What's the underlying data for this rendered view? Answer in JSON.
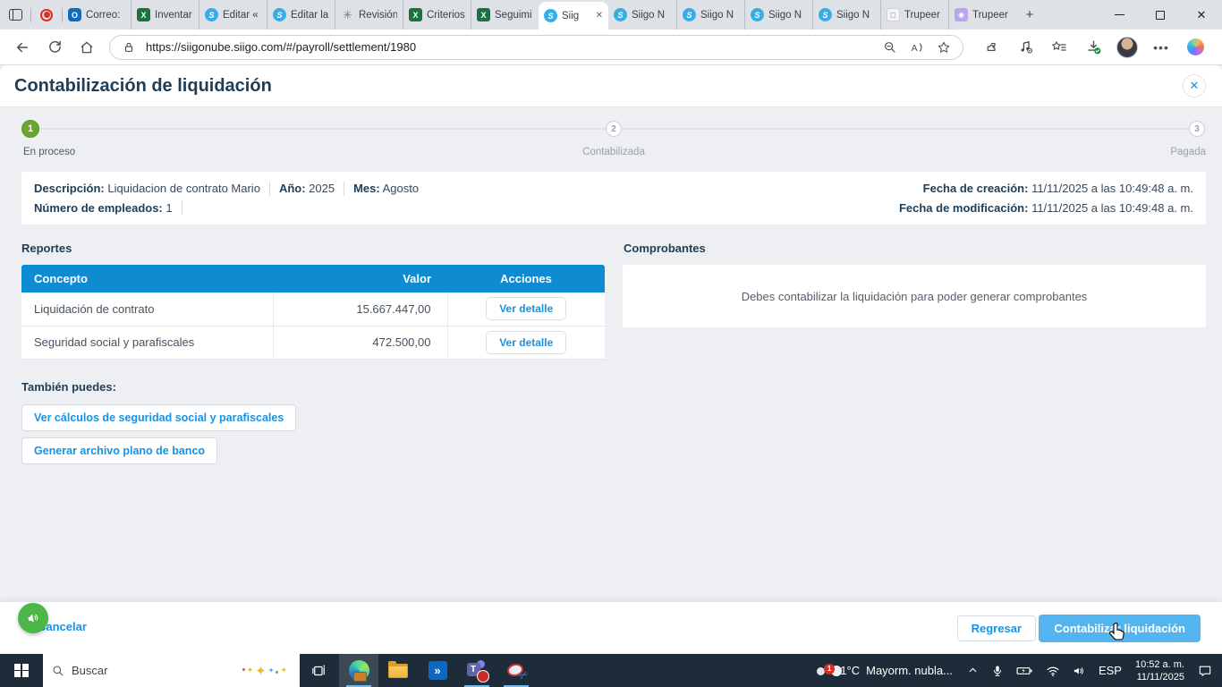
{
  "browser": {
    "tabs": [
      {
        "label": "Correo:",
        "icon": "outlook-icon"
      },
      {
        "label": "Inventar",
        "icon": "excel-icon"
      },
      {
        "label": "Editar «",
        "icon": "siigo-icon"
      },
      {
        "label": "Editar la",
        "icon": "siigo-icon"
      },
      {
        "label": "Revisión",
        "icon": "chatgpt-icon"
      },
      {
        "label": "Criterios",
        "icon": "excel-icon"
      },
      {
        "label": "Seguimi",
        "icon": "excel-icon"
      },
      {
        "label": "Siig",
        "icon": "siigo-icon",
        "active": true
      },
      {
        "label": "Siigo N",
        "icon": "siigo-icon"
      },
      {
        "label": "Siigo N",
        "icon": "siigo-icon"
      },
      {
        "label": "Siigo N",
        "icon": "siigo-icon"
      },
      {
        "label": "Siigo N",
        "icon": "siigo-icon"
      },
      {
        "label": "Trupeer",
        "icon": "trupeer-light-icon"
      },
      {
        "label": "Trupeer",
        "icon": "trupeer-purple-icon"
      }
    ],
    "url": "https://siigonube.siigo.com/#/payroll/settlement/1980"
  },
  "page": {
    "title": "Contabilización de liquidación",
    "stepper": {
      "steps": [
        {
          "number": "1",
          "label": "En proceso",
          "state": "active"
        },
        {
          "number": "2",
          "label": "Contabilizada",
          "state": "pending"
        },
        {
          "number": "3",
          "label": "Pagada",
          "state": "pending"
        }
      ]
    },
    "info": {
      "descripcion_label": "Descripción:",
      "descripcion": "Liquidacion de contrato Mario",
      "anio_label": "Año:",
      "anio": "2025",
      "mes_label": "Mes:",
      "mes": "Agosto",
      "empleados_label": "Número de empleados:",
      "empleados": "1",
      "creacion_label": "Fecha de creación:",
      "creacion": "11/11/2025 a las 10:49:48 a. m.",
      "modificacion_label": "Fecha de modificación:",
      "modificacion": "11/11/2025 a las 10:49:48 a. m."
    },
    "reportes": {
      "heading": "Reportes",
      "columns": [
        "Concepto",
        "Valor",
        "Acciones"
      ],
      "rows": [
        {
          "concepto": "Liquidación de contrato",
          "valor": "15.667.447,00",
          "accion": "Ver detalle"
        },
        {
          "concepto": "Seguridad social y parafiscales",
          "valor": "472.500,00",
          "accion": "Ver detalle"
        }
      ]
    },
    "comprobantes": {
      "heading": "Comprobantes",
      "message": "Debes contabilizar la liquidación para poder generar comprobantes"
    },
    "tambien": {
      "heading": "También puedes:",
      "actions": [
        "Ver cálculos de seguridad social y parafiscales",
        "Generar archivo plano de banco"
      ]
    },
    "footer": {
      "cancel": "Cancelar",
      "regresar": "Regresar",
      "primary": "Contabilizar liquidación"
    }
  },
  "taskbar": {
    "search_placeholder": "Buscar",
    "weather": {
      "badge": "1",
      "temp": "21°C",
      "desc": "Mayorm. nubla..."
    },
    "language": "ESP",
    "time": "10:52 a. m.",
    "date": "11/11/2025"
  },
  "colors": {
    "accent_blue": "#1593e6",
    "table_header_blue": "#0f8bd2",
    "primary_button_blue": "#54b4ef",
    "step_green": "#69a72e",
    "fab_green": "#4cb648",
    "navy_text": "#1f3d54"
  }
}
